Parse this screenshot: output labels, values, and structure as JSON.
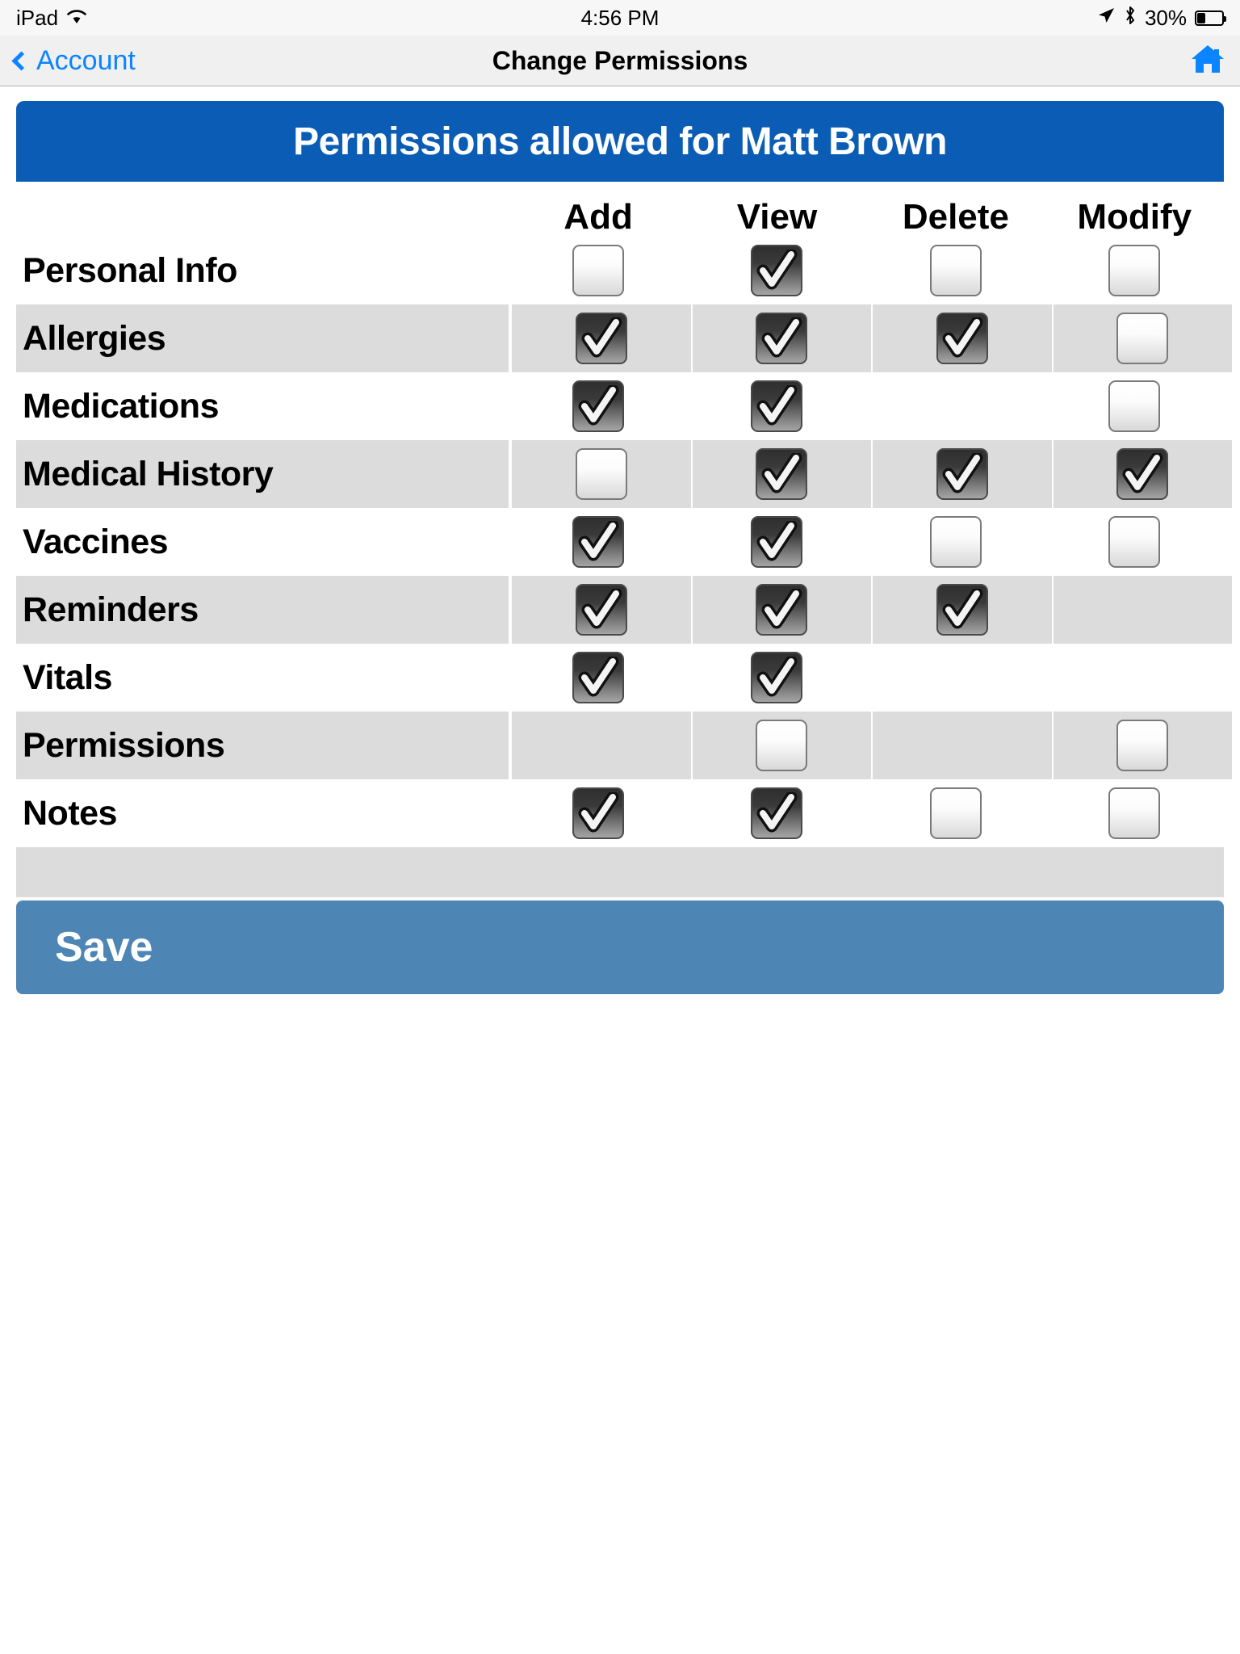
{
  "status_bar": {
    "device": "iPad",
    "wifi_icon": "wifi-icon",
    "time": "4:56 PM",
    "location_icon": "location-arrow-icon",
    "bluetooth_icon": "bluetooth-icon",
    "battery_percent": "30%"
  },
  "nav_bar": {
    "back_label": "Account",
    "back_icon": "chevron-left-icon",
    "title": "Change Permissions",
    "home_icon": "home-icon"
  },
  "banner": {
    "text": "Permissions allowed for Matt Brown",
    "color": "#0a5cb5"
  },
  "table": {
    "columns": [
      "Add",
      "View",
      "Delete",
      "Modify"
    ],
    "rows": [
      {
        "label": "Personal Info",
        "striped": false,
        "cells": [
          "unchecked",
          "checked",
          "unchecked",
          "unchecked"
        ]
      },
      {
        "label": "Allergies",
        "striped": true,
        "cells": [
          "checked",
          "checked",
          "checked",
          "unchecked"
        ]
      },
      {
        "label": "Medications",
        "striped": false,
        "cells": [
          "checked",
          "checked",
          "none",
          "unchecked"
        ]
      },
      {
        "label": "Medical History",
        "striped": true,
        "cells": [
          "unchecked",
          "checked",
          "checked",
          "checked"
        ]
      },
      {
        "label": "Vaccines",
        "striped": false,
        "cells": [
          "checked",
          "checked",
          "unchecked",
          "unchecked"
        ]
      },
      {
        "label": "Reminders",
        "striped": true,
        "cells": [
          "checked",
          "checked",
          "checked",
          "none"
        ]
      },
      {
        "label": "Vitals",
        "striped": false,
        "cells": [
          "checked",
          "checked",
          "none",
          "none"
        ]
      },
      {
        "label": "Permissions",
        "striped": true,
        "cells": [
          "none",
          "unchecked",
          "none",
          "unchecked"
        ]
      },
      {
        "label": "Notes",
        "striped": false,
        "cells": [
          "checked",
          "checked",
          "unchecked",
          "unchecked"
        ]
      }
    ]
  },
  "footer": {
    "save_label": "Save",
    "save_color": "#4d85b4"
  }
}
